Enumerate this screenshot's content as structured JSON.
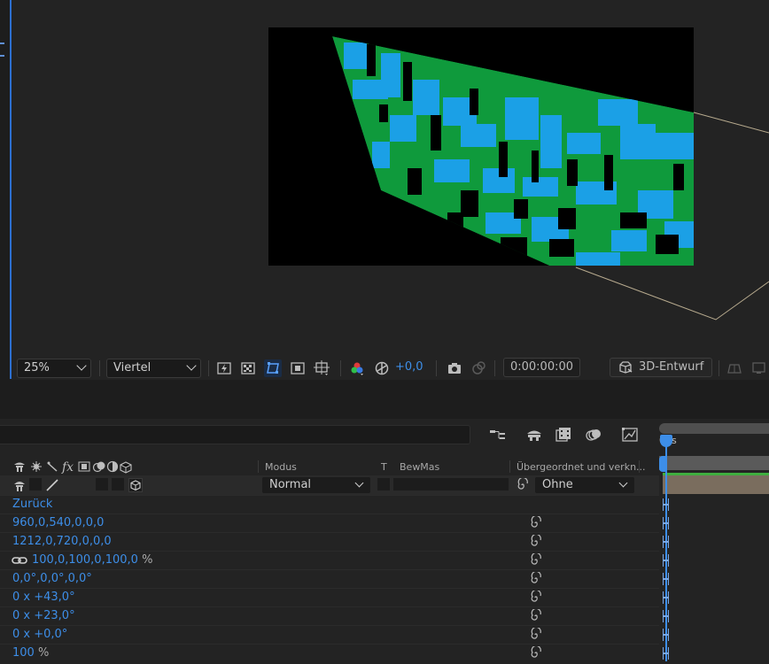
{
  "viewer": {
    "zoom": "25%",
    "resolution": "Viertel",
    "exposure": "+0,0",
    "timecode": "0:00:00:00",
    "renderer": "3D-Entwurf",
    "colors": {
      "green": "#0f9a3c",
      "blue": "#1ba0e6",
      "comp_bg": "#000000",
      "accent": "#2d6fd0"
    }
  },
  "timeline": {
    "ruler_label": "00s",
    "columns": {
      "modus": "Modus",
      "t": "T",
      "bewmas": "BewMas",
      "parent": "Übergeordnet und verkn..."
    },
    "layer": {
      "mode": "Normal",
      "parent": "Ohne"
    },
    "properties": [
      {
        "value": "Zurück",
        "unit": "",
        "spiral": false
      },
      {
        "value": "960,0,540,0,0,0",
        "unit": "",
        "spiral": true
      },
      {
        "value": "1212,0,720,0,0,0",
        "unit": "",
        "spiral": true
      },
      {
        "value": "100,0,100,0,100,0",
        "unit": "%",
        "spiral": true,
        "linked": true
      },
      {
        "value": "0,0°,0,0°,0,0°",
        "unit": "",
        "spiral": true
      },
      {
        "value": "0 x +43,0°",
        "unit": "",
        "spiral": true
      },
      {
        "value": "0 x +23,0°",
        "unit": "",
        "spiral": true
      },
      {
        "value": "0 x +0,0°",
        "unit": "",
        "spiral": true
      },
      {
        "value": "100",
        "unit": "%",
        "spiral": true
      }
    ]
  }
}
